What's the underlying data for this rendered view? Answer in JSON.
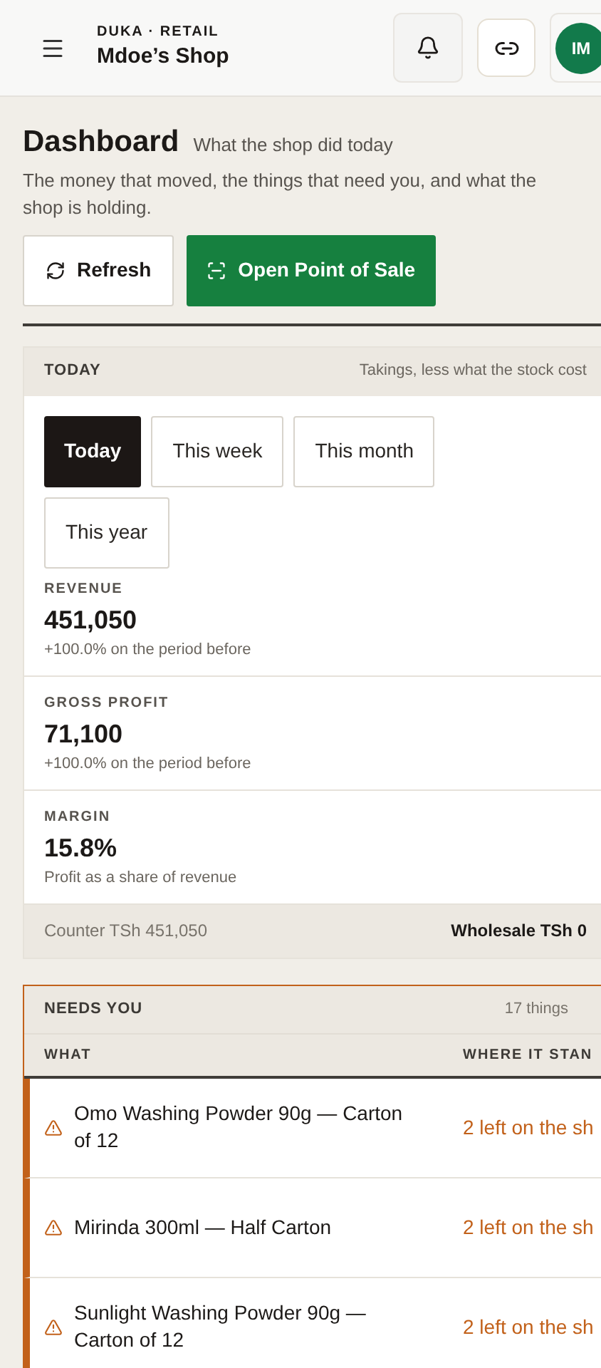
{
  "header": {
    "eyebrow": "DUKA · RETAIL",
    "shop_name": "Mdoe’s Shop",
    "avatar": "IM"
  },
  "page": {
    "title": "Dashboard",
    "subtitle": "What the shop did today",
    "description": "The money that moved, the things that need you, and what the shop is holding."
  },
  "actions": [
    {
      "label": "Refresh",
      "kind": "secondary"
    },
    {
      "label": "Open Point of Sale",
      "kind": "primary"
    }
  ],
  "today": {
    "title": "TODAY",
    "note": "Takings, less what the stock cost",
    "periods": [
      {
        "label": "Today",
        "selected": true
      },
      {
        "label": "This week",
        "selected": false
      },
      {
        "label": "This month",
        "selected": false
      },
      {
        "label": "This year",
        "selected": false
      }
    ],
    "metrics": [
      {
        "label": "REVENUE",
        "value": "451,050",
        "note": "+100.0% on the period before"
      },
      {
        "label": "GROSS PROFIT",
        "value": "71,100",
        "note": "+100.0% on the period before"
      },
      {
        "label": "MARGIN",
        "value": "15.8%",
        "note": "Profit as a share of revenue"
      }
    ],
    "footer_left": "Counter TSh 451,050",
    "footer_right": "Wholesale TSh 0"
  },
  "needs_you": {
    "title": "NEEDS YOU",
    "count": "17 things",
    "columns": [
      "WHAT",
      "WHERE IT STAN"
    ],
    "rows": [
      {
        "what": "Omo Washing Powder 90g — Carton of 12",
        "where": "2 left on the sh"
      },
      {
        "what": "Mirinda 300ml — Half Carton",
        "where": "2 left on the sh"
      },
      {
        "what": "Sunlight Washing Powder 90g — Carton of 12",
        "where": "2 left on the sh"
      }
    ]
  }
}
